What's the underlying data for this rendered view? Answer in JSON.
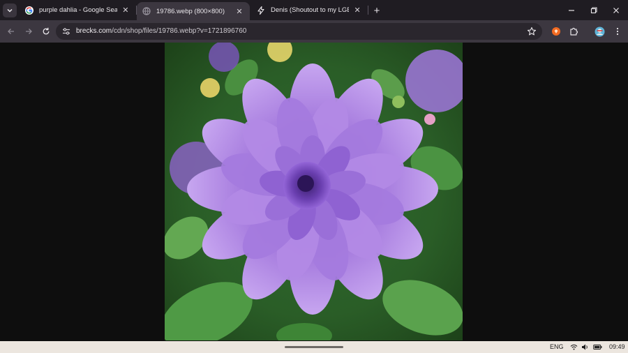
{
  "tabs": [
    {
      "title": "purple dahlia - Google Search",
      "favicon": "google-icon",
      "active": false
    },
    {
      "title": "19786.webp (800×800)",
      "favicon": "globe-icon",
      "active": true
    },
    {
      "title": "Denis (Shoutout to my LGBT+ (",
      "favicon": "bolt-icon",
      "active": false
    }
  ],
  "address_bar": {
    "host": "brecks.com",
    "path": "/cdn/shop/files/19786.webp?v=1721896760"
  },
  "image": {
    "subject": "purple dahlia",
    "colors": {
      "petal": "#9b6ad6",
      "petal_light": "#c4a2ee",
      "leaf": "#3e8a3a"
    }
  },
  "taskbar": {
    "language": "ENG",
    "time": "09:49"
  },
  "colors": {
    "tabstrip": "#1f1c22",
    "toolbar": "#3c3740",
    "omnibox": "#2a262d",
    "content_bg": "#0e0e0e",
    "taskbar": "#ece6df"
  }
}
